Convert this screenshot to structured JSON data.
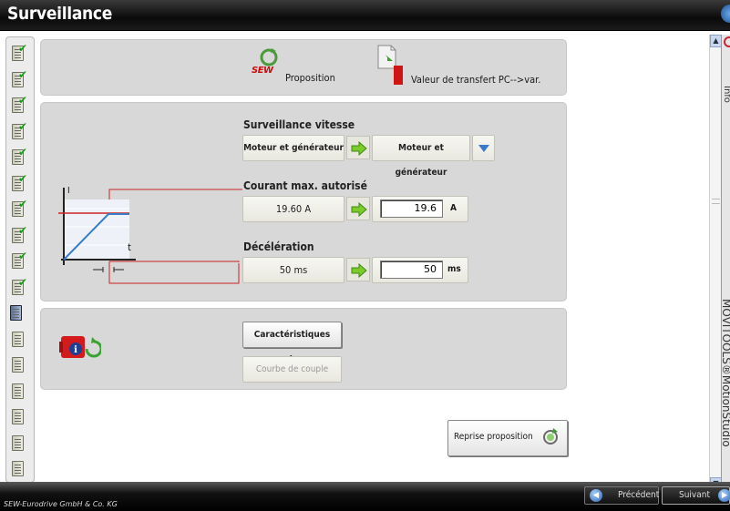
{
  "window": {
    "title": "Surveillance"
  },
  "header_panel": {
    "sew_logo_text": "SEW",
    "proposition_label": "Proposition",
    "transfer_label": "Valeur de transfert PC-->var."
  },
  "speed_monitoring": {
    "title": "Surveillance vitesse",
    "proposed": "Moteur et générateur",
    "selected": "Moteur et générateur"
  },
  "max_current": {
    "title": "Courant max. autorisé",
    "proposed": "19.60 A",
    "value": "19.6",
    "unit": "A"
  },
  "deceleration": {
    "title": "Décélération",
    "proposed": "50 ms",
    "value": "50",
    "unit": "ms"
  },
  "graph": {
    "axis_y": "I",
    "axis_x": "t"
  },
  "motor_panel": {
    "characteristics_button": "Caractéristiques moteur",
    "torque_curve_button": "Courbe de couple"
  },
  "reprise_button": "Reprise proposition",
  "side_tab": {
    "info": "Info",
    "vertical_text": "MOVITOOLS®MotionStudio"
  },
  "footer": {
    "company": "SEW-Eurodrive GmbH & Co. KG",
    "previous": "Précédent",
    "next": "Suivant"
  },
  "nav_items": [
    {
      "done": true
    },
    {
      "done": true
    },
    {
      "done": true
    },
    {
      "done": true
    },
    {
      "done": true
    },
    {
      "done": true
    },
    {
      "done": true
    },
    {
      "done": true
    },
    {
      "done": true
    },
    {
      "done": true
    },
    {
      "done": false,
      "active": true
    },
    {
      "done": false
    },
    {
      "done": false
    },
    {
      "done": false
    },
    {
      "done": false
    },
    {
      "done": false
    },
    {
      "done": false
    }
  ],
  "colors": {
    "accent_red": "#cc2222",
    "arrow_green": "#7ccb2a",
    "panel": "#d8d8d8"
  }
}
